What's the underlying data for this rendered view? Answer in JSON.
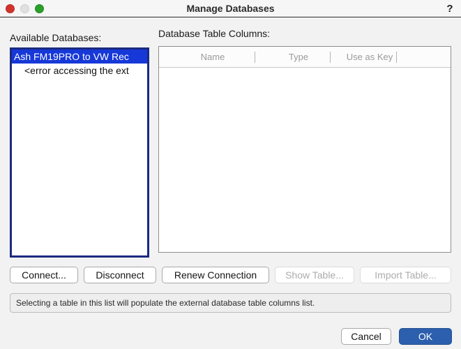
{
  "window": {
    "title": "Manage Databases",
    "help_icon": "?",
    "traffic_lights": {
      "close": "close-button",
      "minimize": "minimize-button",
      "zoom": "zoom-button"
    },
    "colors": {
      "background": "#f2f2f2",
      "selection": "#1638d8",
      "focus_ring": "#1b2a80",
      "default_button": "#2c5fad",
      "close_light": "#d0342c",
      "minimize_light": "#e0e0e0",
      "zoom_light": "#2b9f2b"
    }
  },
  "available_databases": {
    "label": "Available Databases:",
    "items": [
      {
        "text": "Ash FM19PRO to VW Rec",
        "selected": true,
        "indented": false
      },
      {
        "text": "<error accessing the ext",
        "selected": false,
        "indented": true
      }
    ]
  },
  "table_columns": {
    "label": "Database Table Columns:",
    "headers": [
      "Name",
      "Type",
      "Use as Key"
    ],
    "rows": []
  },
  "action_buttons": [
    {
      "label": "Connect...",
      "enabled": true
    },
    {
      "label": "Disconnect",
      "enabled": true
    },
    {
      "label": "Renew Connection",
      "enabled": true
    },
    {
      "label": "Show Table...",
      "enabled": false
    },
    {
      "label": "Import Table...",
      "enabled": false
    }
  ],
  "status": {
    "message": "Selecting a table in this list will populate the external database table columns list."
  },
  "dialog_buttons": {
    "cancel": "Cancel",
    "ok": "OK"
  }
}
